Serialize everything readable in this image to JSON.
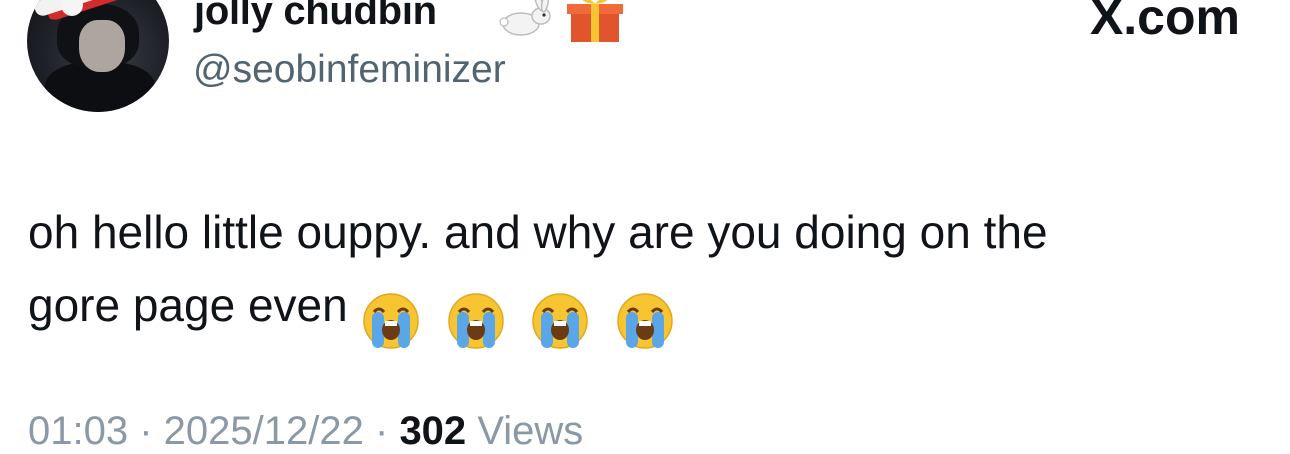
{
  "user": {
    "display_name": "jolly chudbin",
    "handle": "@seobinfeminizer",
    "name_emojis": [
      "rabbit-icon",
      "gift-icon"
    ]
  },
  "watermark": "X.com",
  "tweet": {
    "text_line1": "oh hello little ouppy. and why are you doing on the",
    "text_line2": "gore page even",
    "emojis": [
      "loudly-crying-face",
      "loudly-crying-face",
      "loudly-crying-face",
      "loudly-crying-face"
    ]
  },
  "meta": {
    "time": "01:03",
    "date": "2025/12/22",
    "views_count": "302",
    "views_label": "Views"
  },
  "colors": {
    "text_primary": "#0f1419",
    "text_secondary": "#536471",
    "background": "#ffffff"
  }
}
